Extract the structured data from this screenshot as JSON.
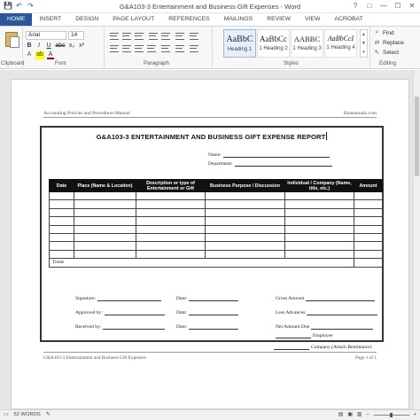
{
  "window": {
    "title": "G&A103-3 Entertainment and Business Gift Expenses - Word",
    "controls": [
      "?",
      "□",
      "—",
      "☐",
      "✕"
    ]
  },
  "qat": {
    "save": "💾",
    "undo": "↶",
    "redo": "↷"
  },
  "tabs": [
    "HOME",
    "INSERT",
    "DESIGN",
    "PAGE LAYOUT",
    "REFERENCES",
    "MAILINGS",
    "REVIEW",
    "VIEW",
    "ACROBAT"
  ],
  "ribbon": {
    "clipboard_label": "Clipboard",
    "font_label": "Font",
    "font_name": "Arial",
    "font_size": "14",
    "format_buttons": [
      "B",
      "I",
      "U",
      "abc",
      "x₂",
      "x²"
    ],
    "font_color_buttons": [
      "A",
      "ab",
      "A"
    ],
    "paragraph_label": "Paragraph",
    "styles_label": "Styles",
    "styles": [
      {
        "sample": "AaBbC",
        "name": "Heading 1"
      },
      {
        "sample": "AaBbCc",
        "name": "1 Heading 2"
      },
      {
        "sample": "AABBC",
        "name": "1 Heading 3"
      },
      {
        "sample": "AaBbCcI",
        "name": "1 Heading 4"
      }
    ],
    "editing_label": "Editing",
    "editing_items": [
      "Find",
      "Replace",
      "Select"
    ]
  },
  "document": {
    "header_left": "Accounting Policies and Procedures Manual",
    "header_right": "Bizmanualz.com",
    "form_title": "G&A103-3 ENTERTAINMENT AND BUSINESS GIFT EXPENSE REPORT",
    "name_label": "Name:",
    "department_label": "Department:",
    "table": {
      "headers": [
        "Date",
        "Place (Name & Location)",
        "Description or type of Entertainment or Gift",
        "Business Purpose / Discussion",
        "Individual / Company (Name, title, etc.)",
        "Amount"
      ],
      "empty_rows": 8,
      "totals_label": "Totals"
    },
    "signature_block": {
      "signature": "Signature:",
      "approved_by": "Approved by:",
      "received_by": "Received by:",
      "date": "Date:",
      "gross_amount": "Gross Amount",
      "less_advances": "Less Advances",
      "net_amount_due": "Net Amount Due",
      "employee": "Employee",
      "company": "Company (Attach Remittance)"
    },
    "footer_left": "G&A103-3 Entertainment and Business Gift Expenses",
    "footer_right": "Page 1 of 1"
  },
  "status": {
    "words": "52 WORDS",
    "zoom_minus": "−",
    "zoom_plus": "+"
  }
}
